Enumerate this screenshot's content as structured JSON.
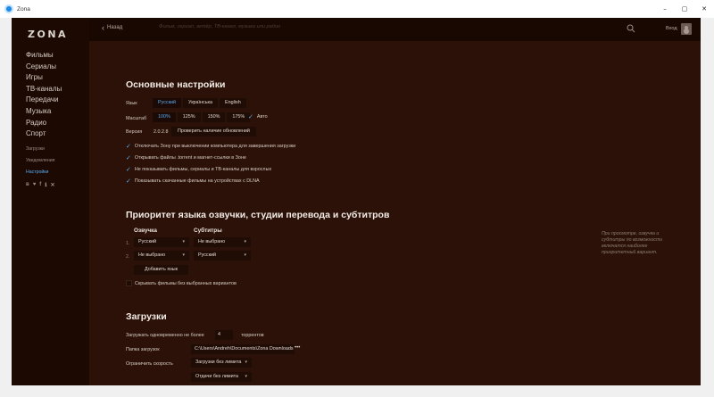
{
  "window": {
    "title": "Zona",
    "controls": [
      "–",
      "▢",
      "✕"
    ]
  },
  "sidebar": {
    "logo": "ZONA",
    "main_items": [
      "Фильмы",
      "Сериалы",
      "Игры",
      "ТВ-каналы",
      "Передачи",
      "Музыка",
      "Радио",
      "Спорт"
    ],
    "sub_items": [
      {
        "label": "Загрузки",
        "active": false
      },
      {
        "label": "Уведомления",
        "active": false
      },
      {
        "label": "Настройки",
        "active": true
      }
    ],
    "socials": [
      "в",
      "♥",
      "f",
      "ℹ",
      "✕"
    ]
  },
  "topbar": {
    "back_label": "Назад",
    "search_placeholder": "Фильм, сериал, актёр, ТВ-канал, музыка или радио",
    "login_label": "Вход"
  },
  "general": {
    "title": "Основные настройки",
    "language_label": "Язык",
    "languages": [
      {
        "label": "Русский",
        "selected": true
      },
      {
        "label": "Українська",
        "selected": false
      },
      {
        "label": "English",
        "selected": false
      }
    ],
    "scale_label": "Масштаб",
    "scales": [
      {
        "label": "100%",
        "selected": true
      },
      {
        "label": "125%",
        "selected": false
      },
      {
        "label": "150%",
        "selected": false
      },
      {
        "label": "175%",
        "selected": false
      }
    ],
    "auto_label": "Авто",
    "version_label": "Версия",
    "version_value": "2.0.2.8",
    "check_updates_label": "Проверить наличие обновлений",
    "checkboxes": [
      "Отключать Зону при выключении компьютера для завершения загрузки",
      "Открывать файлы .torrent и магнет-ссылки в Зоне",
      "Не показывать фильмы, сериалы и ТВ-каналы для взрослых",
      "Показывать скачанные фильмы на устройствах с DLNA"
    ]
  },
  "priority": {
    "title": "Приоритет языка озвучки, студии перевода и субтитров",
    "audio_header": "Озвучка",
    "subs_header": "Субтитры",
    "rows": [
      {
        "num": "1.",
        "audio": "Русский",
        "subs": "Не выбрано"
      },
      {
        "num": "2.",
        "audio": "Не выбрано",
        "subs": "Русский"
      }
    ],
    "add_language_label": "Добавить язык",
    "hide_films_label": "Скрывать фильмы без выбранных вариантов",
    "hint": "При просмотре, озвучка и субтитры по возможности включатся наиболее приоритетный вариант."
  },
  "downloads": {
    "title": "Загрузки",
    "concurrent_label": "Загружать одновременно не более",
    "concurrent_value": "4",
    "concurrent_suffix": "торрентов",
    "folder_label": "Папка загрузок",
    "folder_value": "C:\\Users\\Andreh\\Documents\\Zona Downloads",
    "folder_more": "•••",
    "speed_label": "Ограничить скорость",
    "download_limit": "Загрузки без лимита",
    "upload_limit": "Отдачи без лимита"
  },
  "colors": {
    "accent": "#5aaaf0",
    "background": "#2b1107",
    "sidebar": "#1b0902"
  }
}
